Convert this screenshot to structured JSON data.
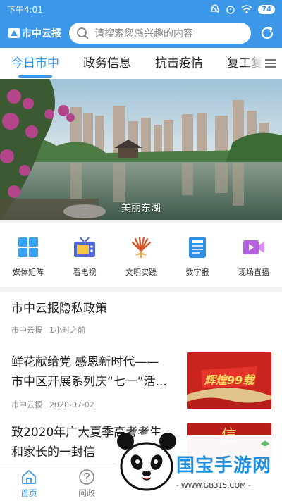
{
  "status_bar": {
    "time": "下午4:01",
    "battery": "74"
  },
  "app_bar": {
    "logo_text": "市中云报",
    "search_placeholder": "请搜索您感兴趣的内容"
  },
  "tabs": [
    {
      "label": "今日市中",
      "active": true
    },
    {
      "label": "政务信息",
      "active": false
    },
    {
      "label": "抗击疫情",
      "active": false
    },
    {
      "label": "复工复产",
      "active": false
    }
  ],
  "banner": {
    "caption": "美丽东湖"
  },
  "quick_links": [
    {
      "label": "媒体矩阵",
      "icon": "grid-icon"
    },
    {
      "label": "看电视",
      "icon": "tv-icon"
    },
    {
      "label": "文明实践",
      "icon": "fan-icon"
    },
    {
      "label": "数字报",
      "icon": "newspaper-icon"
    },
    {
      "label": "现场直播",
      "icon": "video-icon"
    }
  ],
  "news": [
    {
      "title": "市中云报隐私政策",
      "source": "市中云报",
      "time": "1小时之前"
    },
    {
      "title_line1": "鲜花献给党 感恩新时代——",
      "title_line2": "市中区开展系列庆“七一”活...",
      "source": "市中云报",
      "date": "2020-07-02",
      "thumb_text": "辉煌99载"
    },
    {
      "title_line1": "致2020年广大夏季高考考生",
      "title_line2": "和家长的一封信",
      "thumb_text": "信"
    }
  ],
  "bottom_nav": [
    {
      "label": "首页",
      "icon": "home-icon",
      "active": true
    },
    {
      "label": "问政",
      "icon": "question-icon",
      "active": false
    }
  ],
  "watermark": {
    "brand": "国宝手游网",
    "url": "- WWW.GB315.COM -"
  },
  "colors": {
    "primary": "#3d97e8",
    "text": "#222222",
    "meta": "#888888"
  }
}
